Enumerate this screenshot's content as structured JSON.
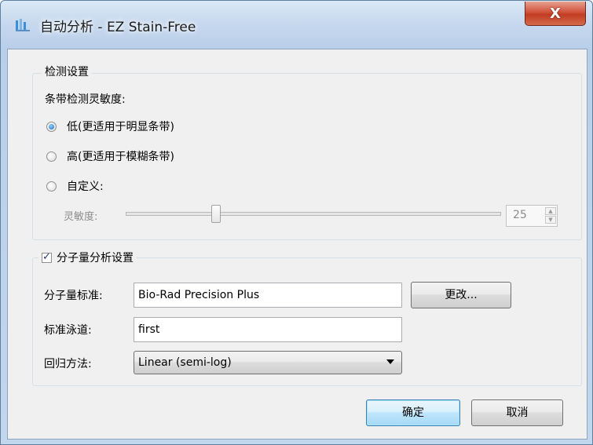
{
  "window": {
    "title": "自动分析 - EZ Stain-Free",
    "close_label": "X"
  },
  "detection": {
    "group_label": "检测设置",
    "sensitivity_heading": "条带检测灵敏度:",
    "options": [
      {
        "label": "低(更适用于明显条带)",
        "selected": true
      },
      {
        "label": "高(更适用于模糊条带)",
        "selected": false
      },
      {
        "label": "自定义:",
        "selected": false
      }
    ],
    "slider_label": "灵敏度:",
    "slider_value_fraction": 0.24,
    "spin_value": "25"
  },
  "mw": {
    "group_label": "分子量分析设置",
    "enabled": true,
    "standard_label": "分子量标准:",
    "standard_value": "Bio-Rad Precision Plus",
    "change_button": "更改...",
    "lane_label": "标准泳道:",
    "lane_value": "first",
    "regression_label": "回归方法:",
    "regression_value": "Linear (semi-log)"
  },
  "buttons": {
    "ok": "确定",
    "cancel": "取消"
  }
}
